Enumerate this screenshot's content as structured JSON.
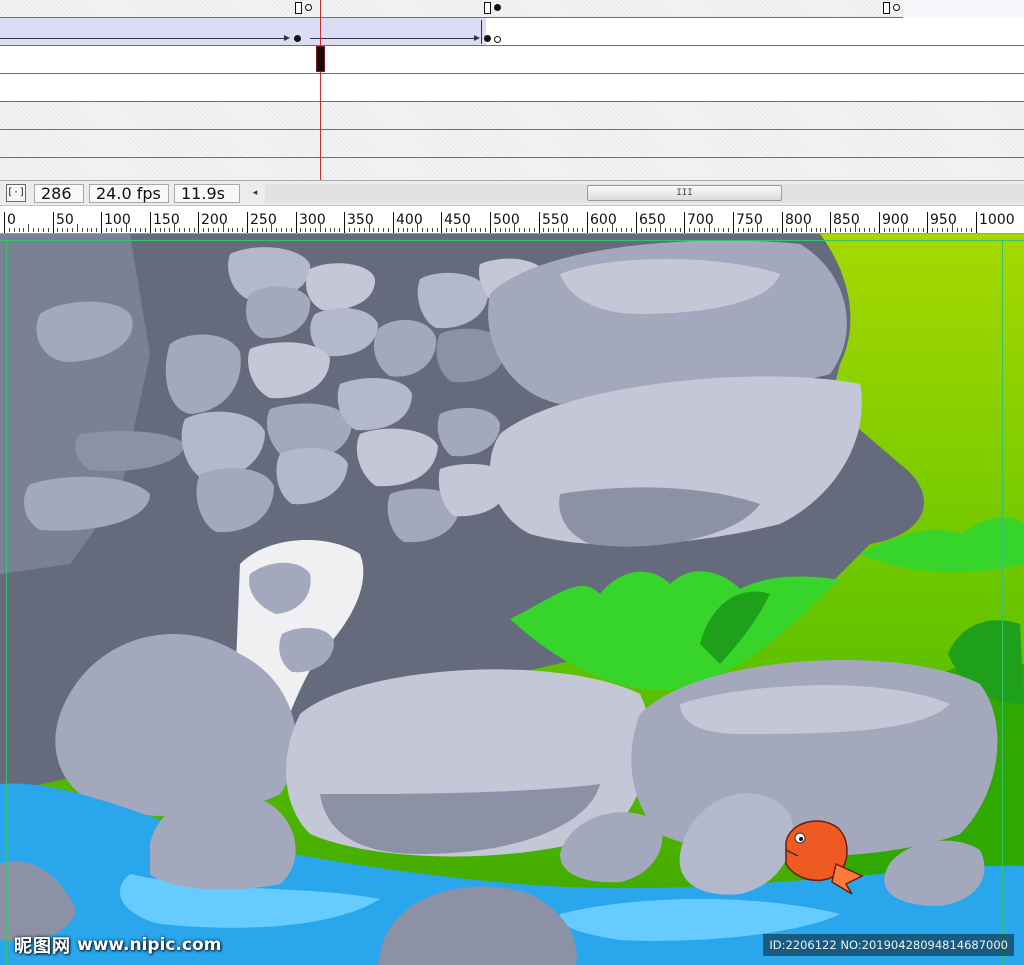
{
  "status": {
    "center_frame_icon": "center-frame-icon",
    "center_frame_glyph": "[·]",
    "current_frame": "286",
    "frame_rate": "24.0 fps",
    "elapsed_time": "11.9s",
    "scroll_left_glyph": "◂",
    "scroll_thumb_glyph": "III"
  },
  "ruler": {
    "labels": [
      "0",
      "50",
      "100",
      "150",
      "200",
      "250",
      "300",
      "350",
      "400",
      "450",
      "500",
      "550",
      "600",
      "650",
      "700",
      "750",
      "800",
      "850",
      "900",
      "950",
      "1000"
    ]
  },
  "timeline": {
    "playhead_frame": 286,
    "layer_count": 6
  },
  "stage": {
    "scene": "cartoon rocky riverbank with green grass and an orange fish",
    "colors": {
      "rock_light": "#c3c7d6",
      "rock_mid": "#a3a8bc",
      "rock_dark": "#656b7c",
      "rock_shadow": "#4f5464",
      "water": "#2aa6ec",
      "water_light": "#66ccff",
      "grass": "#37d42c",
      "background_green": "#9ad400",
      "fish": "#ee5a22"
    }
  },
  "watermark": {
    "brand_cn": "昵图网",
    "brand_url": "www.nipic.com",
    "id_text": "ID:2206122 NO:20190428094814687000"
  }
}
